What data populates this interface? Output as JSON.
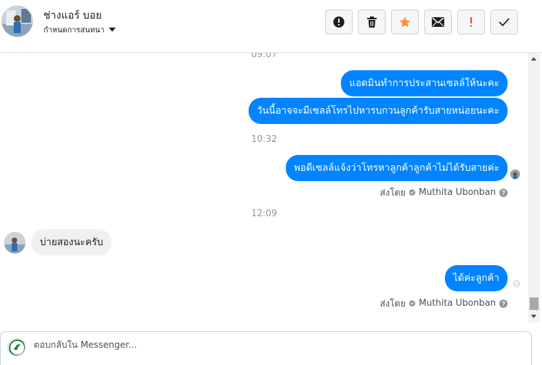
{
  "header": {
    "contact_name": "ช่างแอร์ บอย",
    "conversation_settings": "กำหนดการสนทนา"
  },
  "toolbar": {
    "buttons": [
      {
        "icon": "alert-circle-icon"
      },
      {
        "icon": "trash-icon"
      },
      {
        "icon": "star-icon",
        "color": "#f7923b"
      },
      {
        "icon": "envelope-icon"
      },
      {
        "icon": "exclamation-icon",
        "color": "#fa3e3e"
      },
      {
        "icon": "checkmark-icon"
      }
    ]
  },
  "thread": {
    "timestamps": [
      "09:07",
      "10:32",
      "12:09"
    ],
    "messages": [
      {
        "direction": "outgoing",
        "text": "แอดมินทำการประสานเซลล์ให้นะคะ"
      },
      {
        "direction": "outgoing",
        "text": "วันนี้อาจจะมีเซลล์โทรไปหารบกวนลูกค้ารับสายหน่อยนะคะ"
      },
      {
        "direction": "outgoing",
        "text": "พอดีเซลล์แจ้งว่าโทรหาลูกค้าลูกค้าไม่ได้รับสายค่ะ"
      },
      {
        "direction": "incoming",
        "text": "บ่ายสองนะครับ"
      },
      {
        "direction": "outgoing",
        "text": "ได้ค่ะลูกค้า"
      }
    ],
    "sent_by_label": "ส่งโดย",
    "sent_by_name": "Muthita Ubonban",
    "help_glyph": "?"
  },
  "composer": {
    "placeholder": "ตอบกลับใน Messenger..."
  },
  "colors": {
    "outgoing_bubble": "#0084ff",
    "incoming_bubble": "#f1f0f0",
    "timestamp": "#90949c"
  }
}
